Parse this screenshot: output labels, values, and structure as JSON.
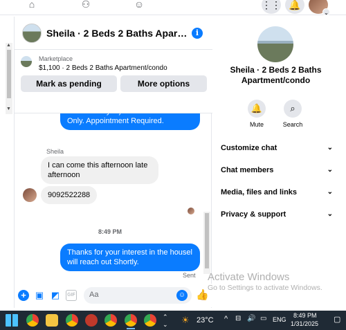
{
  "top_nav": {
    "icons": [
      "home-icon",
      "group-people-icon",
      "community-icon"
    ],
    "right_icons": [
      "menu-grid-icon",
      "notifications-bell-icon"
    ]
  },
  "chat": {
    "header_title": "Sheila · 2 Beds 2 Baths Apartment/condo",
    "marketplace": {
      "label": "Marketplace",
      "listing": "$1,100 · 2 Beds 2 Baths Apartment/condo",
      "mark_pending_label": "Mark as pending",
      "more_options_label": "More options"
    },
    "messages": {
      "outgoing_top": "not contact you).** Self-Guided Tours Only. Appointment Required.",
      "sender_name": "Sheila",
      "incoming_1": "I can come this afternoon late afternoon",
      "incoming_2": "9092522288",
      "timestamp": "8:49 PM",
      "outgoing_last": "Thanks for your interest in the housel will reach out Shortly.",
      "status": "Sent"
    },
    "composer": {
      "placeholder": "Aa"
    }
  },
  "info_panel": {
    "title": "Sheila · 2 Beds 2 Baths Apartment/condo",
    "mute_label": "Mute",
    "search_label": "Search",
    "sections": [
      "Customize chat",
      "Chat members",
      "Media, files and links",
      "Privacy & support"
    ]
  },
  "watermark": {
    "line1": "Activate Windows",
    "line2": "Go to Settings to activate Windows."
  },
  "taskbar": {
    "weather": "23°C",
    "language": "ENG",
    "time": "8:49 PM",
    "date": "1/31/2025"
  },
  "colors": {
    "messenger_blue": "#0a7cff",
    "bubble_gray": "#f0f0f0",
    "taskbar_bg": "#1f2a35"
  }
}
